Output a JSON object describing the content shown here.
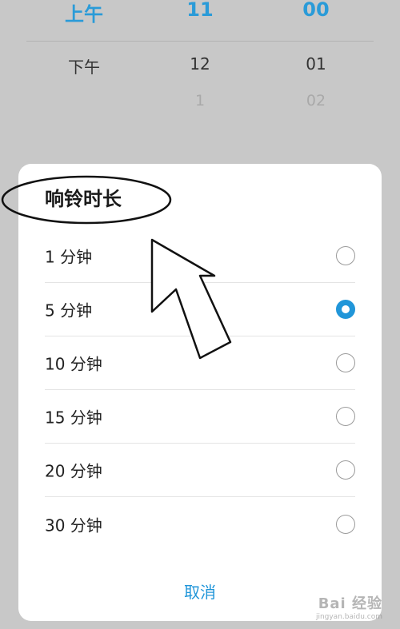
{
  "picker": {
    "columns": [
      {
        "selected": "上午",
        "next": "下午",
        "next2": ""
      },
      {
        "selected": "11",
        "next": "12",
        "next2": "1"
      },
      {
        "selected": "00",
        "next": "01",
        "next2": "02"
      }
    ]
  },
  "dialog": {
    "title": "响铃时长",
    "options": [
      {
        "label": "1 分钟",
        "checked": false
      },
      {
        "label": "5 分钟",
        "checked": true
      },
      {
        "label": "10 分钟",
        "checked": false
      },
      {
        "label": "15 分钟",
        "checked": false
      },
      {
        "label": "20 分钟",
        "checked": false
      },
      {
        "label": "30 分钟",
        "checked": false
      }
    ],
    "cancel_label": "取消"
  },
  "watermark": {
    "line1": "Bai 经验",
    "line2": "jingyan.baidu.com"
  },
  "colors": {
    "accent": "#2196d9",
    "picker_selected": "#2a9bd8",
    "background": "#c8c8c8"
  }
}
